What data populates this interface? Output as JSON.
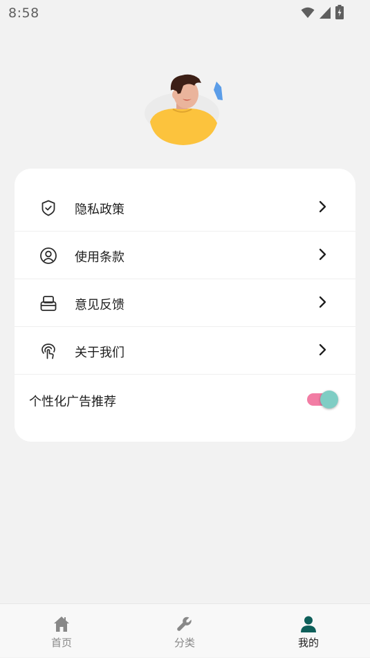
{
  "status_bar": {
    "time": "8:58"
  },
  "menu": {
    "items": [
      {
        "label": "隐私政策",
        "icon": "shield-check-icon"
      },
      {
        "label": "使用条款",
        "icon": "user-circle-icon"
      },
      {
        "label": "意见反馈",
        "icon": "inbox-icon"
      },
      {
        "label": "关于我们",
        "icon": "touch-hand-icon"
      }
    ],
    "toggle": {
      "label": "个性化广告推荐",
      "enabled": true
    }
  },
  "bottom_nav": {
    "items": [
      {
        "label": "首页",
        "icon": "home-icon",
        "active": false
      },
      {
        "label": "分类",
        "icon": "wrench-icon",
        "active": false
      },
      {
        "label": "我的",
        "icon": "person-icon",
        "active": true
      }
    ]
  },
  "colors": {
    "background": "#f2f2f2",
    "card": "#ffffff",
    "toggle_track": "#f27da4",
    "toggle_thumb": "#7fcdc4",
    "active_nav_icon": "#0e5f5a",
    "inactive_nav": "#888888"
  }
}
